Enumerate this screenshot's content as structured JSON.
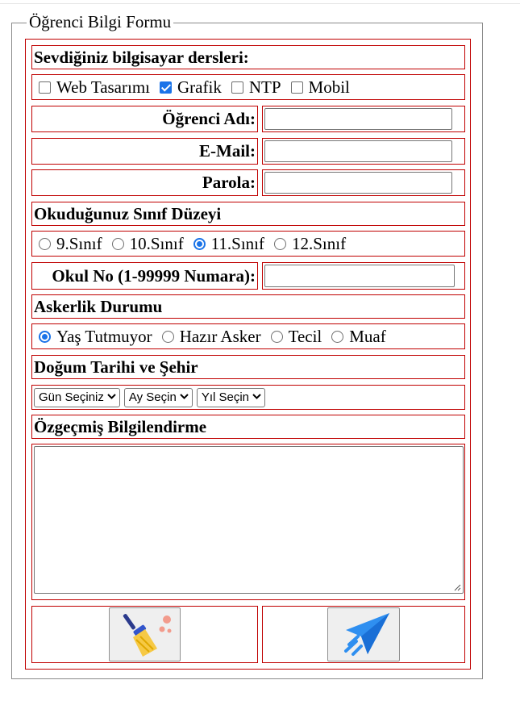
{
  "form": {
    "legend": "Öğrenci Bilgi Formu",
    "courses_heading": "Sevdiğiniz bilgisayar dersleri:",
    "courses": [
      {
        "label": "Web Tasarımı",
        "checked": false
      },
      {
        "label": "Grafik",
        "checked": true
      },
      {
        "label": "NTP",
        "checked": false
      },
      {
        "label": "Mobil",
        "checked": false
      }
    ],
    "name_label": "Öğrenci Adı:",
    "name_value": "",
    "email_label": "E-Mail:",
    "email_value": "",
    "password_label": "Parola:",
    "password_value": "",
    "grade_heading": "Okuduğunuz Sınıf Düzeyi",
    "grades": [
      {
        "label": "9.Sınıf",
        "selected": false
      },
      {
        "label": "10.Sınıf",
        "selected": false
      },
      {
        "label": "11.Sınıf",
        "selected": true
      },
      {
        "label": "12.Sınıf",
        "selected": false
      }
    ],
    "school_no_label": "Okul No (1-99999 Numara):",
    "school_no_value": "",
    "military_heading": "Askerlik Durumu",
    "military": [
      {
        "label": "Yaş Tutmuyor",
        "selected": true
      },
      {
        "label": "Hazır Asker",
        "selected": false
      },
      {
        "label": "Tecil",
        "selected": false
      },
      {
        "label": "Muaf",
        "selected": false
      }
    ],
    "birth_heading": "Doğum Tarihi ve Şehir",
    "day_select": "Gün Seçiniz",
    "month_select": "Ay Seçin",
    "year_select": "Yıl Seçin",
    "cv_heading": "Özgeçmiş Bilgilendirme",
    "cv_value": "",
    "reset_icon": "broom-icon",
    "submit_icon": "paper-plane-icon",
    "accent_color": "#1a73e8",
    "border_color": "#c00000"
  }
}
